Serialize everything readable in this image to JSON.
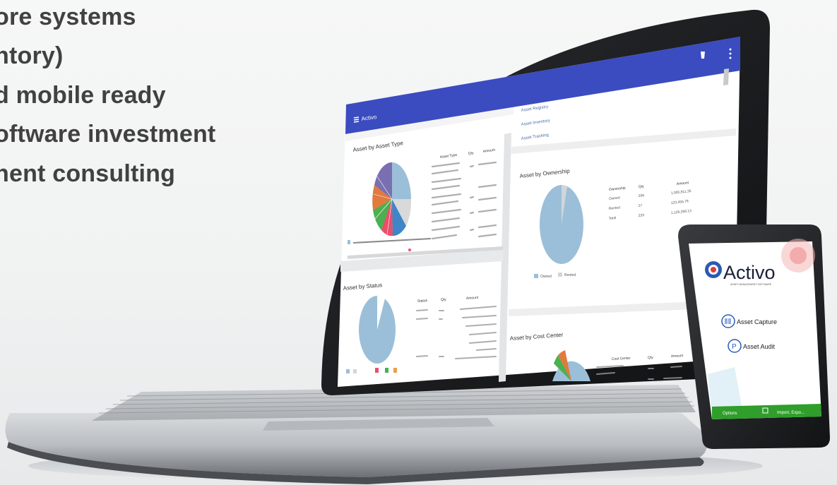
{
  "bullets": [
    "ore systems",
    "ntory)",
    "d mobile ready",
    "oftware investment",
    "nent consulting"
  ],
  "laptop": {
    "app_title": "Activo",
    "side_links": [
      "Asset Registry",
      "Asset Inventory",
      "Asset Tracking"
    ],
    "panels": {
      "asset_type": {
        "title": "Asset by Asset Type",
        "col_headers": [
          "Asset Type",
          "Qty",
          "Amount"
        ]
      },
      "ownership": {
        "title": "Asset by Ownership",
        "col_headers": [
          "Ownership",
          "Qty",
          "Amount"
        ],
        "rows": [
          [
            "Owned",
            "206",
            "1,005,811.35"
          ],
          [
            "Rented",
            "27",
            "123,456.78"
          ],
          [
            "Total",
            "233",
            "1,129,268.13"
          ]
        ],
        "legend": [
          "Owned",
          "Rented"
        ]
      },
      "status": {
        "title": "Asset by Status",
        "col_headers": [
          "Status",
          "Qty",
          "Amount"
        ]
      },
      "cost_center": {
        "title": "Asset by Cost Center",
        "col_headers": [
          "Cost Center",
          "Qty",
          "Amount"
        ]
      }
    }
  },
  "phone": {
    "brand": "Activo",
    "tagline": "ASSET MANAGEMENT SOFTWARE",
    "menu": [
      {
        "icon": "barcode-icon",
        "label": "Asset Capture"
      },
      {
        "icon": "audit-icon",
        "label": "Asset Audit"
      }
    ],
    "footer_left": "Options",
    "footer_right": "Import, Expo..."
  },
  "colors": {
    "header_blue": "#3b4cc0",
    "pie_blue": "#9bbfd8",
    "phone_green": "#2f9e2a",
    "text_dark": "#414141"
  }
}
